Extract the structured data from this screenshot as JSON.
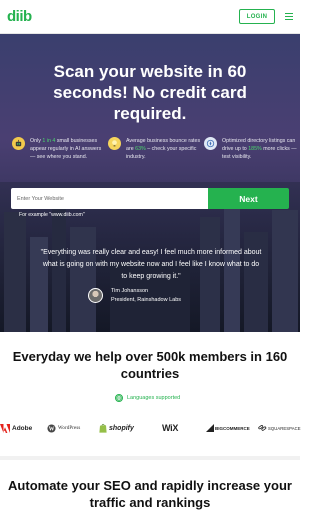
{
  "header": {
    "logo_text": "diib",
    "login_label": "LOGIN",
    "menu_icon": "hamburger-icon"
  },
  "hero": {
    "title": "Scan your website in 60 seconds! No credit card required.",
    "features": [
      {
        "icon": "robot-icon",
        "pre": "Only ",
        "highlight": "1 in 4",
        "post": " small businesses appear regularly in AI answers — see where you stand."
      },
      {
        "icon": "lightbulb-icon",
        "pre": "Average business bounce rates are ",
        "highlight": "63%",
        "post": " – check your specific industry."
      },
      {
        "icon": "compass-icon",
        "pre": "Optimized directory listings can drive up to ",
        "highlight": "185%",
        "post": " more clicks — test visibility."
      }
    ],
    "search": {
      "placeholder": "Enter Your Website"
    },
    "next_label": "Next",
    "example_text": "For example \"www.diib.com\"",
    "testimonial": {
      "quote": "\"Everything was really clear and easy! I feel much more informed about what is going on with my website now and I feel like I know what to do to keep growing it.\"",
      "author_name": "Tim Johansson",
      "author_role": "President, Rainshadow Labs"
    }
  },
  "members": {
    "title": "Everyday we help over 500k members in 160 countries",
    "languages_label": "Languages supported"
  },
  "partners": [
    "Adobe",
    "WordPress",
    "shopify",
    "WiX",
    "BIGCOMMERCE",
    "SQUARESPACE"
  ],
  "automate": {
    "title": "Automate your SEO and rapidly increase your traffic and rankings"
  },
  "colors": {
    "brand_green": "#25b24f",
    "highlight_green": "#4ad66d"
  }
}
